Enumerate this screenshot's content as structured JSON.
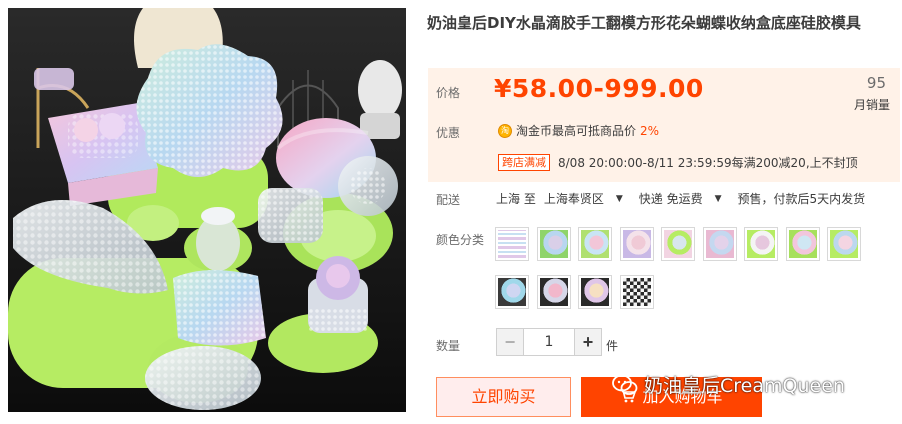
{
  "product": {
    "title": "奶油皇后DIY水晶滴胶手工翻模方形花朵蝴蝶收纳盒底座硅胶模具",
    "image_alt": "水晶滴胶硅胶模具成品展示"
  },
  "price": {
    "label": "价格",
    "value": "¥58.00-999.00",
    "sales_count": "95",
    "sales_label": "月销量"
  },
  "promo": {
    "label": "优惠",
    "coin_icon": "coin-icon",
    "coin_text": "淘金币最高可抵商品价",
    "coin_percent": "2%",
    "cross_tag": "跨店满减",
    "cross_text": "8/08 20:00:00-8/11 23:59:59每满200减20,上不封顶"
  },
  "shipping": {
    "label": "配送",
    "from": "上海 至",
    "to": "上海奉贤区",
    "method": "快递 免运费",
    "note": "预售，付款后5天内发货"
  },
  "colors": {
    "label": "颜色分类",
    "swatch_count": 13
  },
  "quantity": {
    "label": "数量",
    "value": "1",
    "unit": "件",
    "minus": "−",
    "plus": "+"
  },
  "actions": {
    "buy_now": "立即购买",
    "add_cart": "加入购物车"
  },
  "watermark": "奶油皇后CreamQueen",
  "colors_theme": {
    "accent": "#ff4400",
    "price_bg": "#fff2e8"
  }
}
